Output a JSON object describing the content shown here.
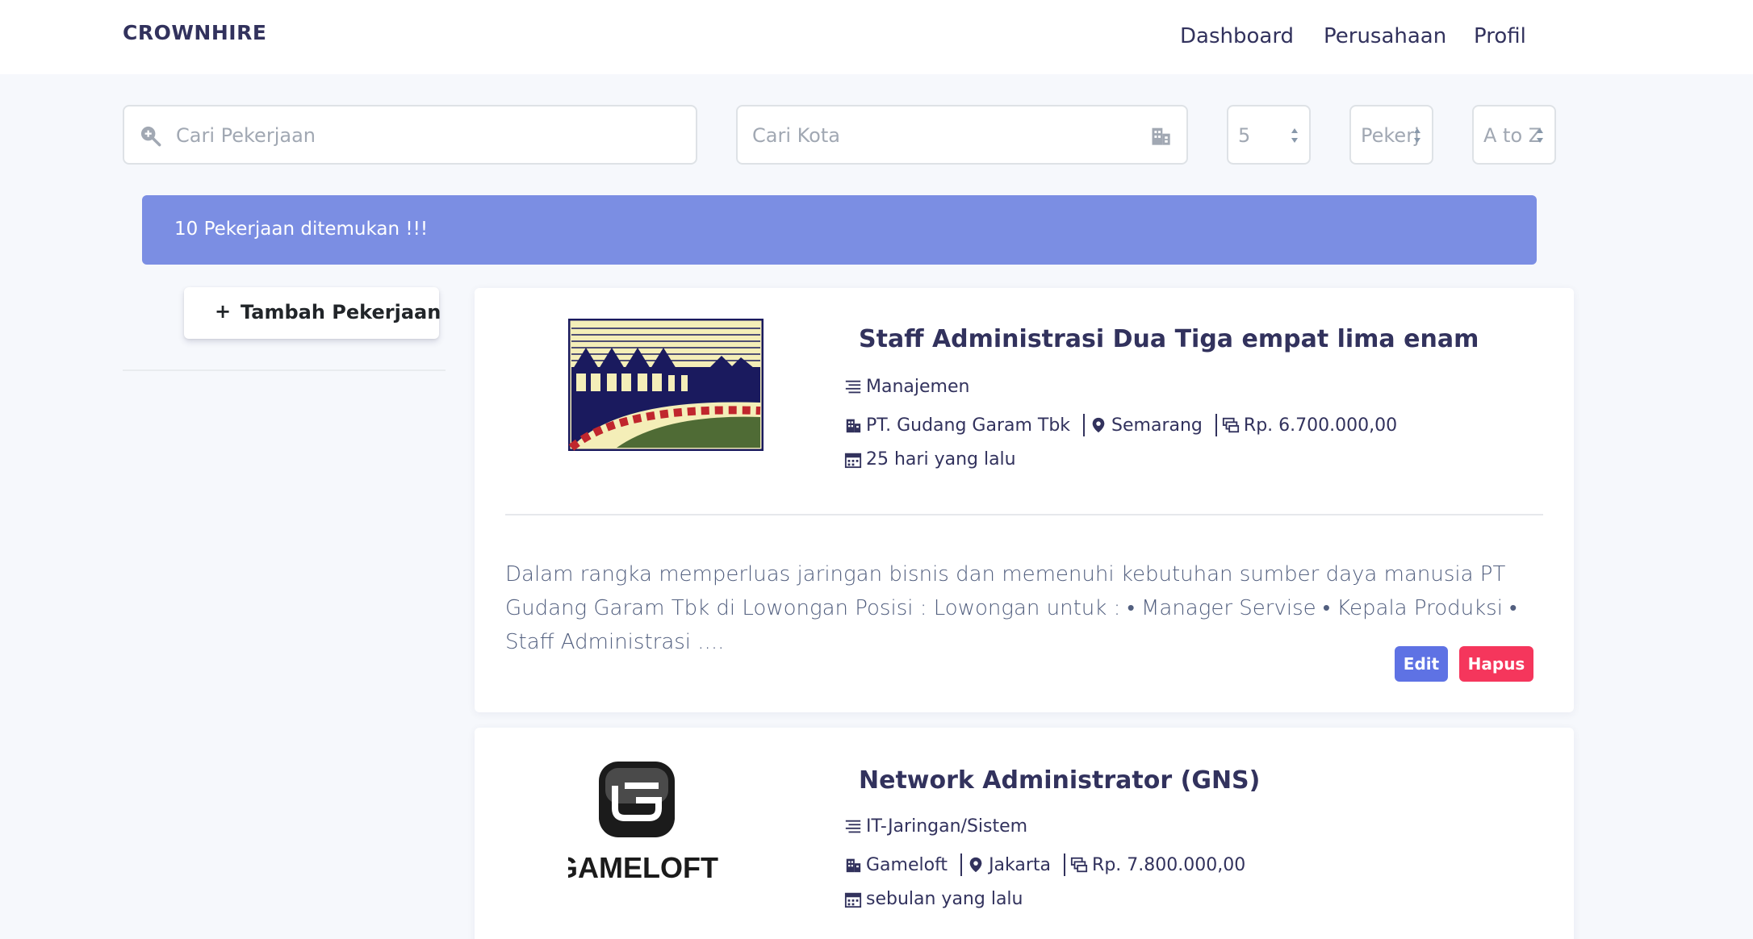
{
  "navbar": {
    "brand": "CROWNHIRE",
    "links": [
      "Dashboard",
      "Perusahaan",
      "Profil"
    ]
  },
  "filters": {
    "search_job_placeholder": "Cari Pekerjaan",
    "search_city_placeholder": "Cari Kota",
    "per_page": "5",
    "category": "Pekerj",
    "sort": "A to Z"
  },
  "alert": {
    "message": "10 Pekerjaan ditemukan !!!"
  },
  "sidebar": {
    "add_button": "Tambah Pekerjaan"
  },
  "jobs": [
    {
      "title": "Staff Administrasi Dua Tiga empat lima enam",
      "category": "Manajemen",
      "company": "PT. Gudang Garam Tbk",
      "city": "Semarang",
      "salary": "Rp. 6.700.000,00",
      "posted": "25 hari yang lalu",
      "description": "Dalam rangka memperluas jaringan bisnis dan memenuhi kebutuhan sumber daya manusia PT Gudang Garam Tbk di Lowongan Posisi : Lowongan untuk : • Manager Servise • Kepala Produksi • Staff Administrasi ....",
      "edit_label": "Edit",
      "delete_label": "Hapus",
      "logo": "gudang-garam-logo"
    },
    {
      "title": "Network Administrator (GNS)",
      "category": "IT-Jaringan/Sistem",
      "company": "Gameloft",
      "city": "Jakarta",
      "salary": "Rp. 7.800.000,00",
      "posted": "sebulan yang lalu",
      "logo": "gameloft-logo",
      "logo_text": "GAMELOFT"
    }
  ],
  "colors": {
    "primary": "#5e72e4",
    "danger": "#f5365c",
    "alert": "#7b8ee3",
    "text": "#32325d"
  }
}
